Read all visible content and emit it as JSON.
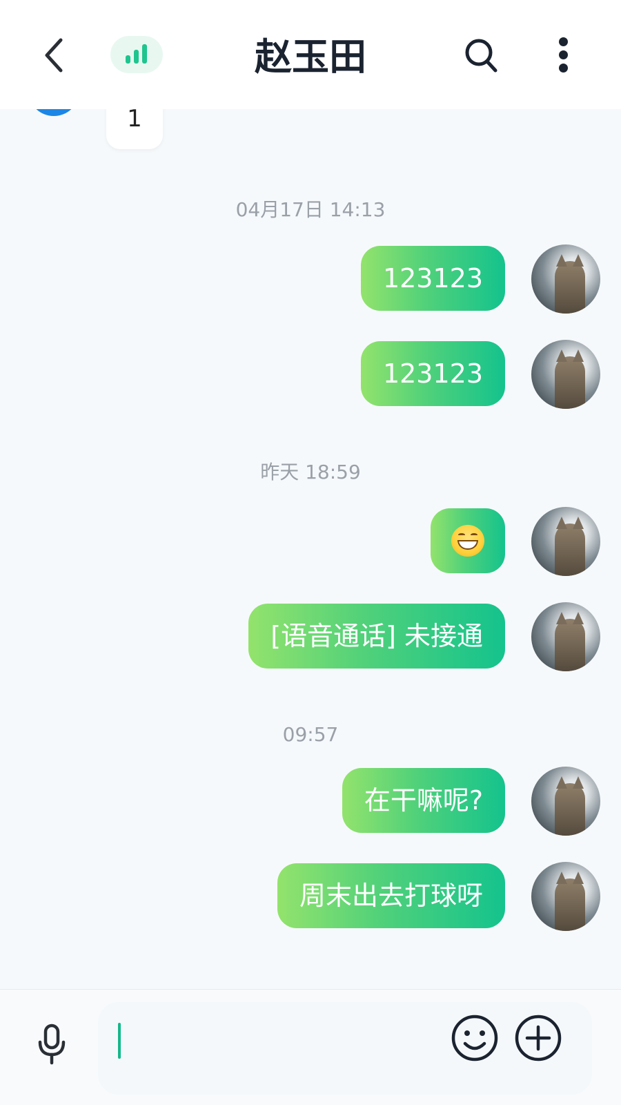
{
  "header": {
    "title": "赵玉田",
    "accent_color": "#1ec58e"
  },
  "partial_message": {
    "text": "1",
    "avatar_color": "#1b86e6"
  },
  "messages": [
    {
      "timestamp": "04月17日 14:13"
    },
    {
      "text": "123123"
    },
    {
      "text": "123123"
    },
    {
      "timestamp": "昨天 18:59"
    },
    {
      "emoji": "grinning-face-emoji"
    },
    {
      "text": "[语音通话] 未接通"
    },
    {
      "timestamp": "09:57"
    },
    {
      "text": "在干嘛呢?"
    },
    {
      "text": "周末出去打球呀"
    }
  ],
  "bubble_gradient": [
    "#93e36c",
    "#14c38d"
  ],
  "input": {
    "value": "",
    "placeholder": ""
  }
}
